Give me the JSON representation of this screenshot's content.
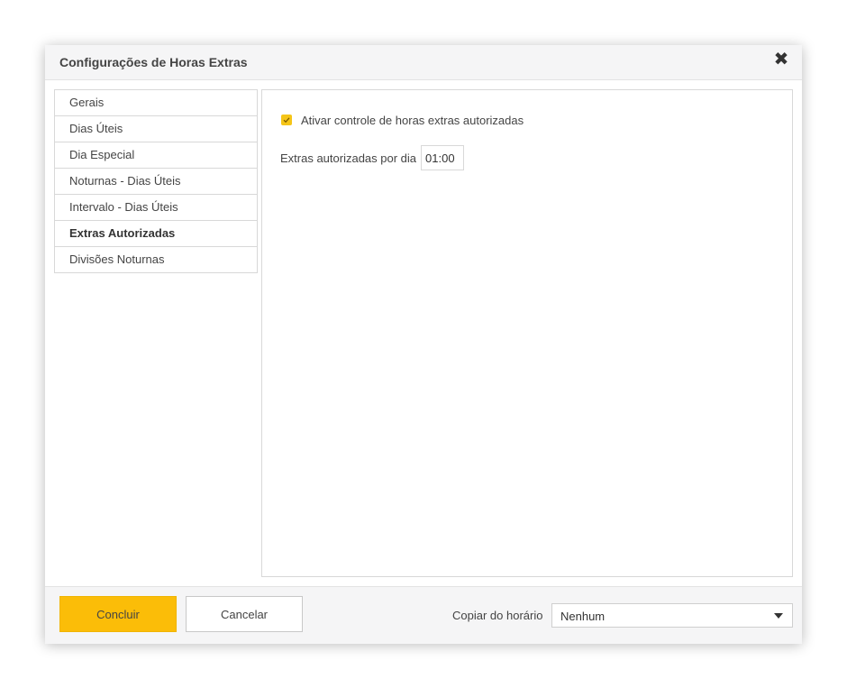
{
  "dialog": {
    "title": "Configurações de Horas Extras",
    "close_icon": "close-icon"
  },
  "nav": {
    "items": [
      {
        "label": "Gerais",
        "active": false
      },
      {
        "label": "Dias Úteis",
        "active": false
      },
      {
        "label": "Dia Especial",
        "active": false
      },
      {
        "label": "Noturnas - Dias Úteis",
        "active": false
      },
      {
        "label": "Intervalo - Dias Úteis",
        "active": false
      },
      {
        "label": "Extras Autorizadas",
        "active": true
      },
      {
        "label": "Divisões Noturnas",
        "active": false
      }
    ]
  },
  "content": {
    "enable_checkbox": {
      "label": "Ativar controle de horas extras autorizadas",
      "checked": true
    },
    "daily_field": {
      "label": "Extras autorizadas por dia",
      "value": "01:00"
    }
  },
  "footer": {
    "conclude_label": "Concluir",
    "cancel_label": "Cancelar",
    "copy_label": "Copiar do horário",
    "copy_selected": "Nenhum"
  },
  "colors": {
    "accent": "#fbbd08",
    "checkbox": "#f5c518"
  }
}
